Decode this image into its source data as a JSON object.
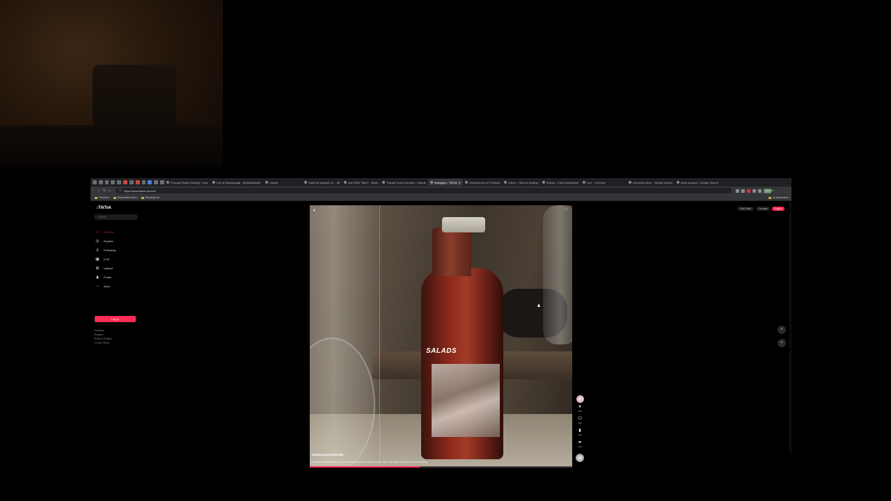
{
  "browser": {
    "tabs": [
      {
        "label": "Prosody Studio Hosting - hoxc"
      },
      {
        "label": "City of Mississauga - MyWebBuilder"
      },
      {
        "label": "Claude"
      },
      {
        "label": "ClickFire Apparel Co. - Mt"
      },
      {
        "label": "ask GitFit \"Bitch\" - Black"
      },
      {
        "label": "Claude Code overview - Claude"
      },
      {
        "label": "Instagram - TikTok",
        "active": true
      },
      {
        "label": "Homebuy for for Portfolio"
      },
      {
        "label": "Merch - Host an hosting"
      },
      {
        "label": "Refuse - Clerk Dashboard"
      },
      {
        "label": "Live - YouTube"
      },
      {
        "label": "extension store - Google search"
      },
      {
        "label": "shop account - Google Search"
      }
    ],
    "address": "https://www.tiktok.com/en/",
    "update_label": "Update",
    "bookmarks": [
      "Favorites",
      "Bookmarks Menu",
      "Reading List"
    ],
    "all_bookmarks": "All Bookmarks"
  },
  "tiktok": {
    "logo": "TikTok",
    "search_placeholder": "Search",
    "nav": [
      {
        "label": "For You",
        "icon": "home-icon",
        "active": true
      },
      {
        "label": "Explore",
        "icon": "compass-icon"
      },
      {
        "label": "Following",
        "icon": "following-icon"
      },
      {
        "label": "LIVE",
        "icon": "live-icon"
      },
      {
        "label": "Upload",
        "icon": "upload-icon"
      },
      {
        "label": "Profile",
        "icon": "profile-icon"
      },
      {
        "label": "More",
        "icon": "more-icon"
      }
    ],
    "login_label": "Log in",
    "footer": [
      "Company",
      "Program",
      "Terms & Policies",
      "© 2025 TikTok"
    ],
    "top_right": {
      "get_coins": "Get Coins",
      "get_app": "Get app",
      "login": "Log in"
    },
    "video": {
      "caption_word": "SALADS",
      "author": "bdsdiruuuesdcdseidi",
      "description": "Everything tastes like a first season prequel live 48th theyre. #fyp #spoopy #foodpranks #satisfying",
      "progress": 0.42,
      "likes": "4.6K",
      "comments": "126",
      "saves": "341",
      "shares": "1.5K"
    }
  }
}
